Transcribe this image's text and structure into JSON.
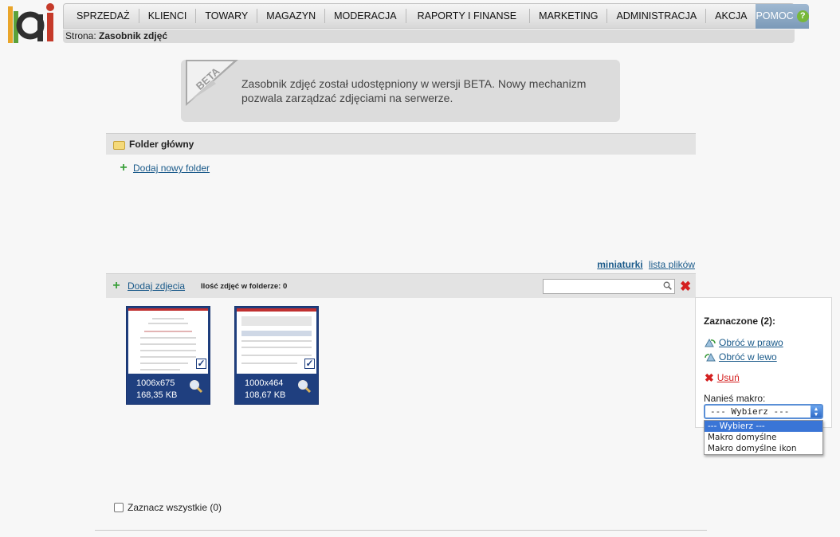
{
  "logo": {
    "text": "ai"
  },
  "nav": {
    "items": [
      "SPRZEDAŻ",
      "KLIENCI",
      "TOWARY",
      "MAGAZYN",
      "MODERACJA",
      "RAPORTY I FINANSE",
      "MARKETING",
      "ADMINISTRACJA",
      "AKCJA"
    ],
    "help": "POMOC",
    "help_icon": "?"
  },
  "breadcrumb": {
    "prefix": "Strona:",
    "current": "Zasobnik zdjęć"
  },
  "beta": {
    "badge": "BETA",
    "message": "Zasobnik zdjęć został udostępniony w wersji BETA. Nowy mechanizm pozwala zarządzać zdjęciami na serwerze."
  },
  "folder": {
    "title": "Folder główny",
    "add_folder": "Dodaj nowy folder"
  },
  "view": {
    "thumbnails": "miniaturki",
    "file_list": "lista plików"
  },
  "photos": {
    "add_photos": "Dodaj zdjęcia",
    "count_label": "Ilość zdjęć w folderze: 0",
    "search_placeholder": "",
    "items": [
      {
        "dims": "1006x675",
        "size": "168,35 KB",
        "checked": true
      },
      {
        "dims": "1000x464",
        "size": "108,67 KB",
        "checked": true
      }
    ]
  },
  "select_all": "Zaznacz wszystkie (0)",
  "side": {
    "selected_title": "Zaznaczone (2):",
    "rotate_right": "Obróć w prawo",
    "rotate_left": "Obróć w lewo",
    "delete": "Usuń",
    "macro_label": "Nanieś makro:",
    "macro_value": "--- Wybierz ---",
    "macro_options": [
      "--- Wybierz ---",
      "Makro domyślne",
      "Makro domyślne ikon"
    ]
  },
  "colors": {
    "accent": "#1f3f7f",
    "link": "#1a5a8a",
    "danger": "#d42020",
    "add": "#3aa03a"
  }
}
